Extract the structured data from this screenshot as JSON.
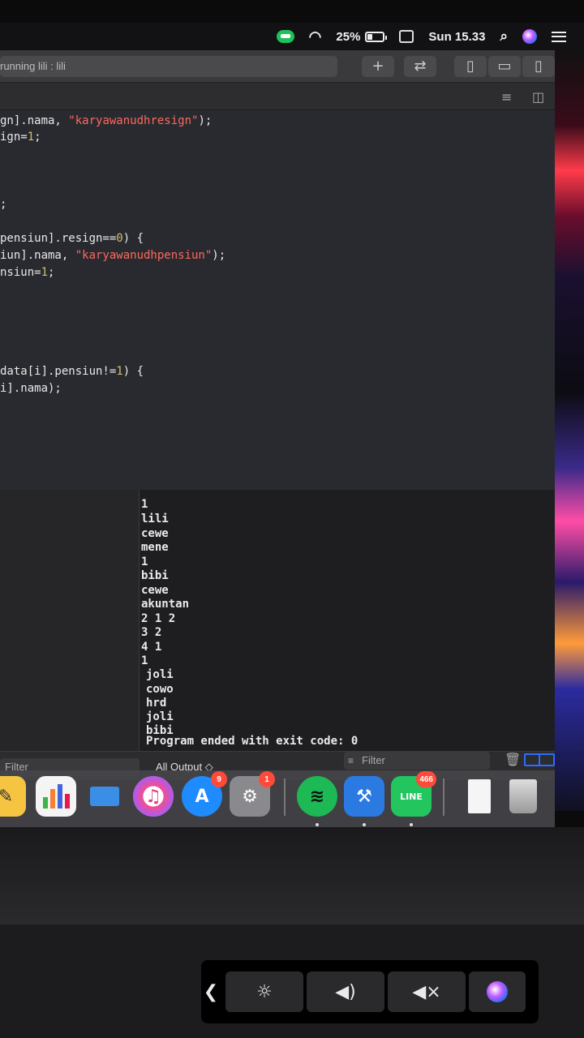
{
  "menubar": {
    "battery_percent": "25%",
    "clock": "Sun 15.33"
  },
  "toolbar": {
    "activity_text": "running lili : lili"
  },
  "editor": {
    "lines": [
      {
        "t1": "gn].nama, ",
        "s": "\"karyawanudhresign\"",
        "t2": ");"
      },
      {
        "t1": "ign=",
        "n": "1",
        "t2": ";"
      },
      {
        "t1": ";"
      },
      {
        "t1": "pensiun].resign==",
        "n": "0",
        "t2": ") {"
      },
      {
        "t1": "iun].nama, ",
        "s": "\"karyawanudhpensiun\"",
        "t2": ");"
      },
      {
        "t1": "nsiun=",
        "n": "1",
        "t2": ";"
      },
      {
        "t1": "data[i].pensiun!=",
        "n": "1",
        "t2": ") {"
      },
      {
        "t1": "i].nama);"
      }
    ]
  },
  "console": {
    "lines": [
      "1",
      "lili",
      "cewe",
      "mene",
      "1",
      "bibi",
      "cewe",
      "akuntan",
      "2 1 2",
      "3 2",
      "4 1",
      "1",
      "joli",
      "cowo",
      "hrd",
      "joli",
      "bibi",
      "Program ended with exit code: 0"
    ]
  },
  "debug_bar": {
    "filter_left": "Filter",
    "output_selector": "All Output ◇",
    "filter_right": "Filter"
  },
  "dock": {
    "appstore_badge": "9",
    "prefs_badge": "1",
    "line_badge": "466",
    "line_label": "LINE"
  },
  "colors": {
    "string": "#fc6a5d",
    "number": "#d0bf69",
    "accent": "#2d6cff"
  }
}
